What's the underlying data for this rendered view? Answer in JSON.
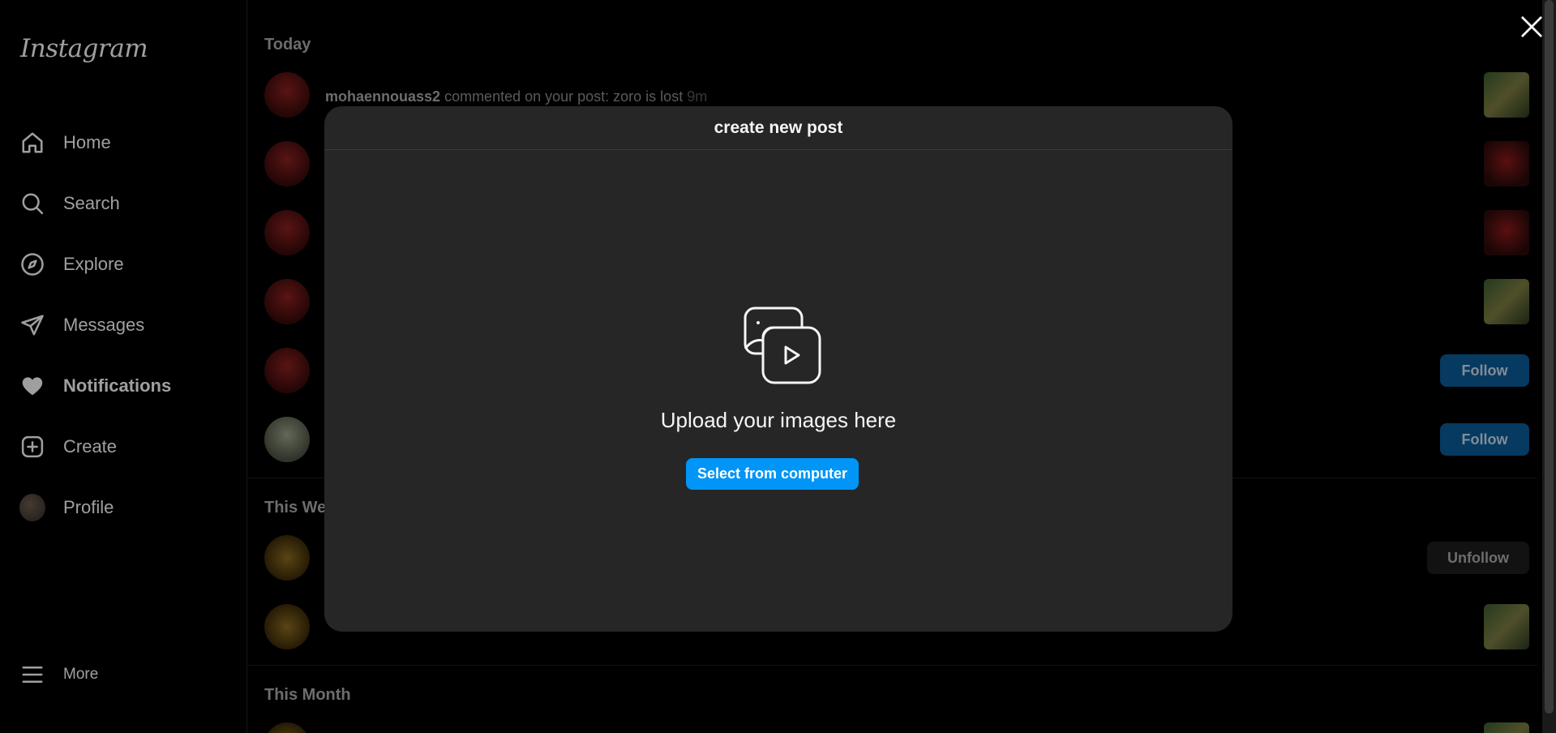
{
  "app": {
    "logo": "Instagram"
  },
  "sidebar": {
    "items": [
      {
        "label": "Home",
        "icon": "home-icon"
      },
      {
        "label": "Search",
        "icon": "search-icon"
      },
      {
        "label": "Explore",
        "icon": "compass-icon"
      },
      {
        "label": "Messages",
        "icon": "paper-plane-icon"
      },
      {
        "label": "Notifications",
        "icon": "heart-icon",
        "active": true
      },
      {
        "label": "Create",
        "icon": "plus-square-icon"
      },
      {
        "label": "Profile",
        "icon": "avatar"
      }
    ],
    "more_label": "More"
  },
  "notifications": {
    "sections": {
      "today": "Today",
      "this_week": "This We",
      "this_month": "This Month"
    },
    "first": {
      "user": "mohaennouass2",
      "action": "commented on your post: zoro is lost",
      "time": "9m"
    },
    "follow_label": "Follow",
    "unfollow_label": "Unfollow"
  },
  "modal": {
    "title": "create new post",
    "upload_text": "Upload your images here",
    "select_button": "Select from computer"
  },
  "colors": {
    "accent": "#0095f6",
    "modal_bg": "#262626",
    "background": "#000000"
  }
}
